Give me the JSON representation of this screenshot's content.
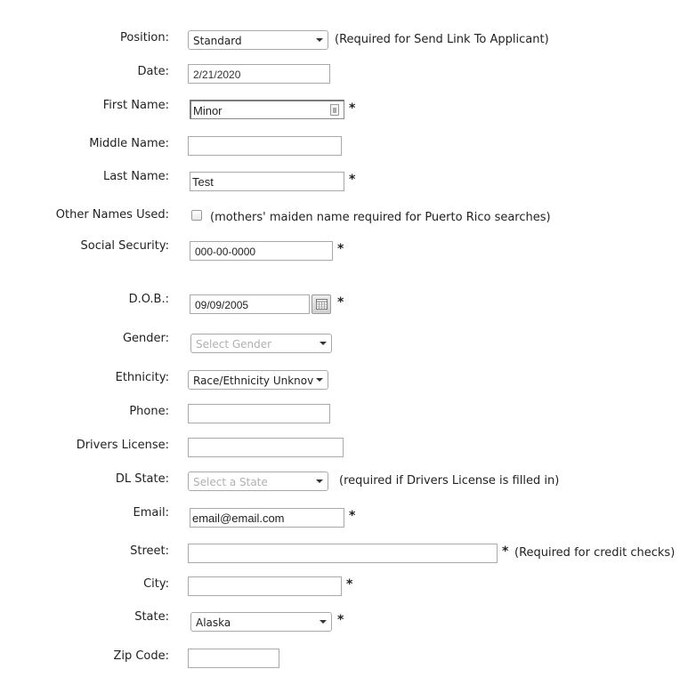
{
  "form": {
    "position": {
      "label": "Position:",
      "value": "Standard",
      "note": "(Required for Send Link To Applicant)"
    },
    "date": {
      "label": "Date:",
      "value": "2/21/2020"
    },
    "first_name": {
      "label": "First Name:",
      "value": "Minor",
      "required": "*"
    },
    "middle_name": {
      "label": "Middle Name:",
      "value": ""
    },
    "last_name": {
      "label": "Last Name:",
      "value": "Test",
      "required": "*"
    },
    "other_names": {
      "label": "Other Names Used:",
      "checked": false,
      "note": "(mothers' maiden name required for Puerto Rico searches)"
    },
    "ssn": {
      "label": "Social Security:",
      "value": "000-00-0000",
      "required": "*"
    },
    "dob": {
      "label": "D.O.B.:",
      "value": "09/09/2005",
      "required": "*"
    },
    "gender": {
      "label": "Gender:",
      "placeholder": "Select Gender"
    },
    "ethnicity": {
      "label": "Ethnicity:",
      "value": "Race/Ethnicity Unknov"
    },
    "phone": {
      "label": "Phone:",
      "value": ""
    },
    "drivers_license": {
      "label": "Drivers License:",
      "value": ""
    },
    "dl_state": {
      "label": "DL State:",
      "placeholder": "Select a State",
      "note": "(required if Drivers License is filled in)"
    },
    "email": {
      "label": "Email:",
      "value": "email@email.com",
      "required": "*"
    },
    "street": {
      "label": "Street:",
      "value": "",
      "required": "*",
      "note": "(Required for credit checks)"
    },
    "city": {
      "label": "City:",
      "value": "",
      "required": "*"
    },
    "state": {
      "label": "State:",
      "value": "Alaska",
      "required": "*"
    },
    "zip": {
      "label": "Zip Code:",
      "value": ""
    }
  }
}
